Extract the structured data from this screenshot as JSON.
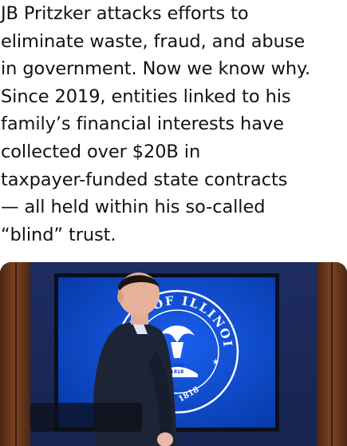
{
  "post": {
    "lines": [
      "JB Pritzker attacks efforts to",
      "eliminate waste, fraud, and abuse",
      "in government. Now we know why.",
      "Since 2019, entities linked to his",
      "family’s financial interests have",
      "collected over $20B in",
      "taxpayer-funded state contracts",
      "— all held within his so-called",
      "“blind” trust."
    ]
  },
  "media": {
    "seal_text_top": "STATE OF ILLINOIS",
    "seal_year_1": "1868",
    "seal_year_2": "1818",
    "seal_year_outer": "1818",
    "colors": {
      "wall": "#1b2a59",
      "screen": "#0a45c8",
      "wood": "#6b3a1c",
      "suit": "#1c2436"
    }
  }
}
